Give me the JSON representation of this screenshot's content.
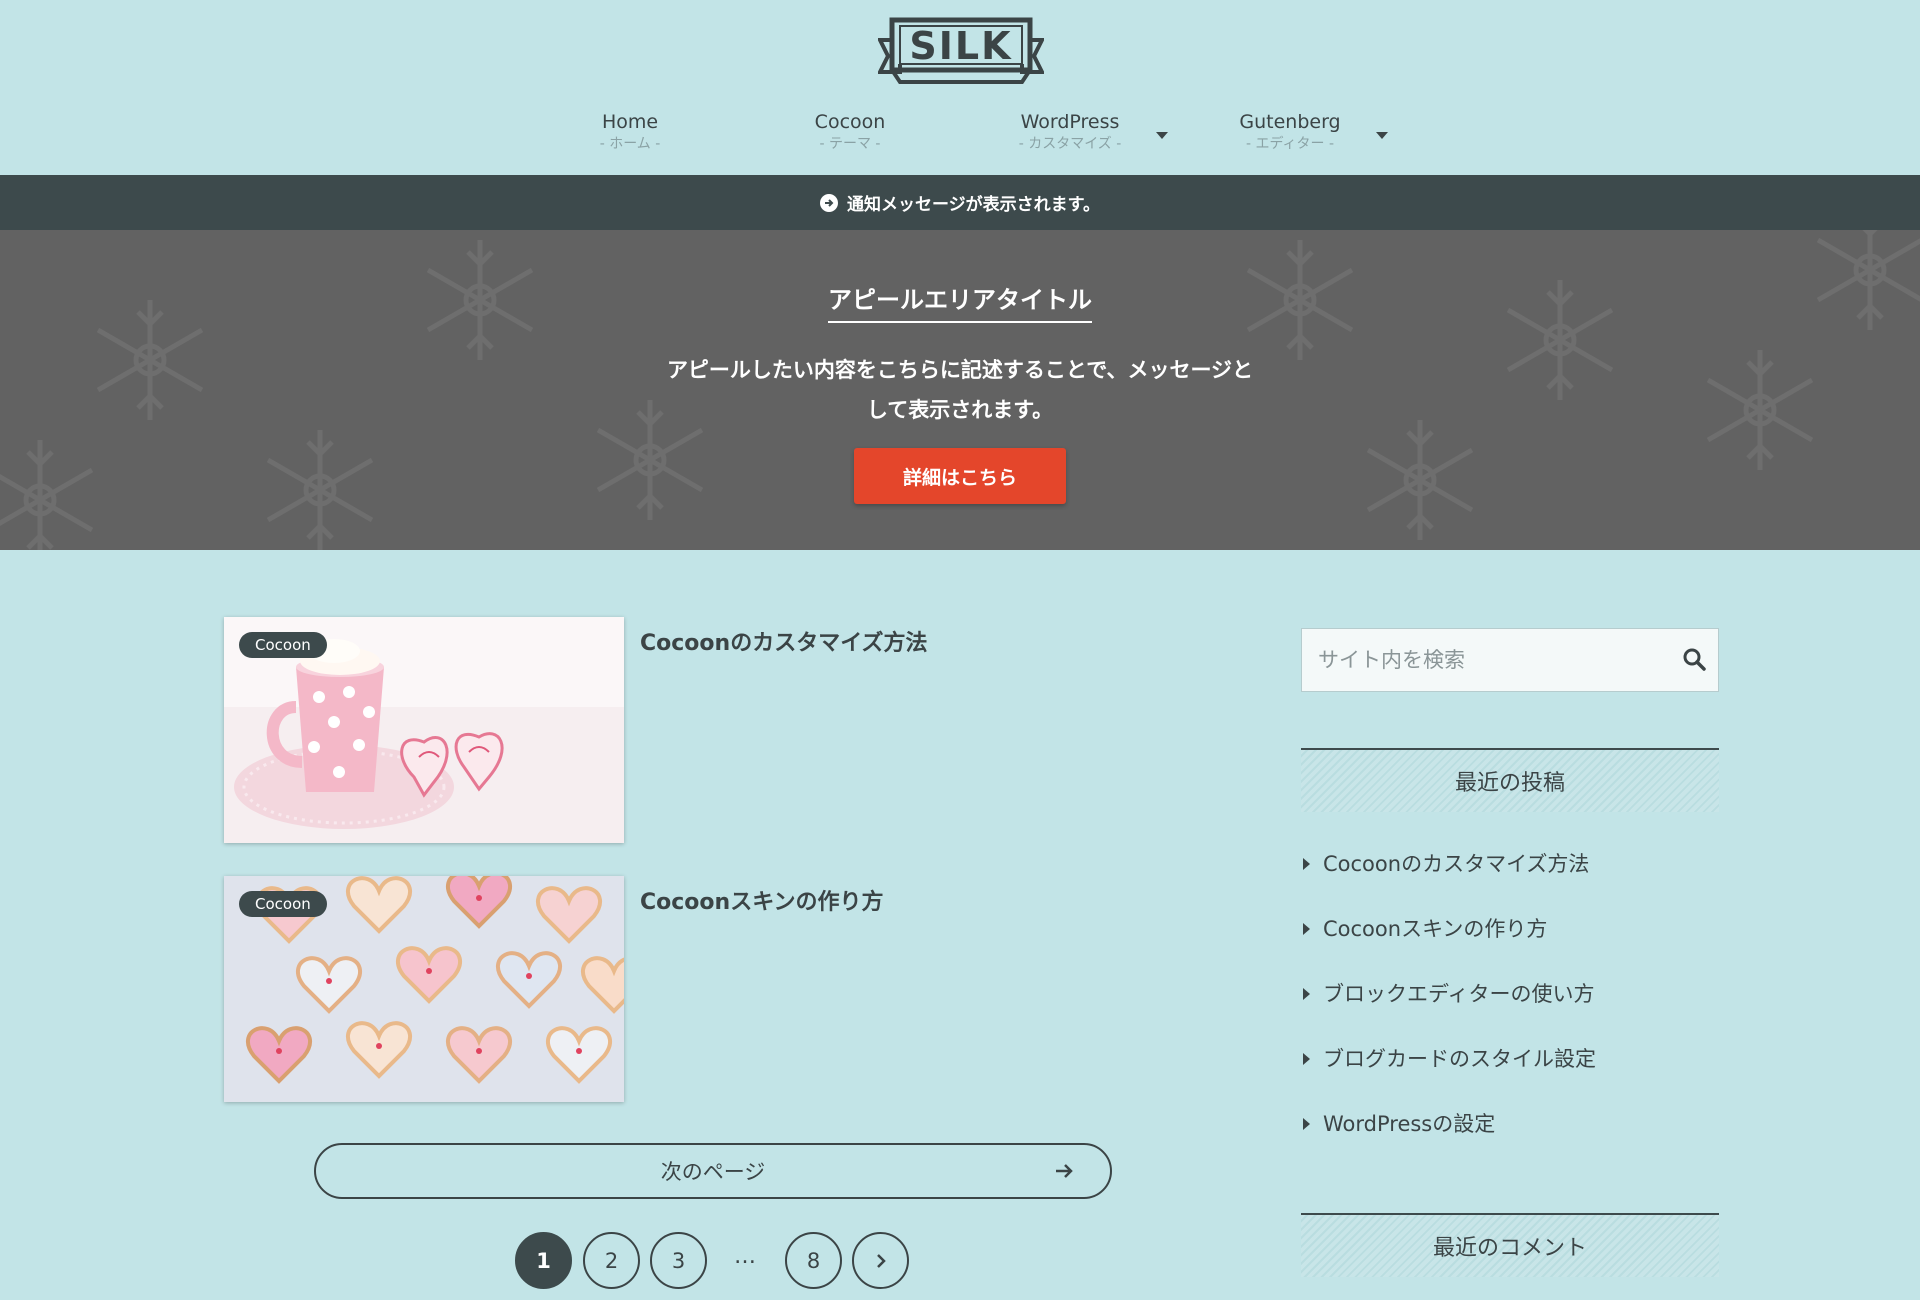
{
  "site": {
    "logo_text": "SILK"
  },
  "nav": {
    "items": [
      {
        "label": "Home",
        "sub": "- ホーム -"
      },
      {
        "label": "Cocoon",
        "sub": "- テーマ -"
      },
      {
        "label": "WordPress",
        "sub": "- カスタマイズ -"
      },
      {
        "label": "Gutenberg",
        "sub": "- エディター -"
      }
    ]
  },
  "notice": {
    "text": "通知メッセージが表示されます。",
    "icon": "arrow-right-circle-icon"
  },
  "appeal": {
    "title": "アピールエリアタイトル",
    "message_line1": "アピールしたい内容をこちらに記述することで、メッセージと",
    "message_line2": "して表示されます。",
    "button_label": "詳細はこちら",
    "button_color": "#e4462b"
  },
  "posts": [
    {
      "category": "Cocoon",
      "title": "Cocoonのカスタマイズ方法"
    },
    {
      "category": "Cocoon",
      "title": "Cocoonスキンの作り方"
    }
  ],
  "next_page": {
    "label": "次のページ"
  },
  "pagination": {
    "pages": [
      "1",
      "2",
      "3",
      "8"
    ],
    "ellipsis": "…",
    "current": "1"
  },
  "sidebar": {
    "search_placeholder": "サイト内を検索",
    "recent_title": "最近の投稿",
    "recent_posts": [
      "Cocoonのカスタマイズ方法",
      "Cocoonスキンの作り方",
      "ブロックエディターの使い方",
      "ブログカードのスタイル設定",
      "WordPressの設定"
    ],
    "comments_title": "最近のコメント"
  },
  "colors": {
    "background": "#c2e4e7",
    "dark": "#3d4a4c",
    "accent": "#e4462b"
  }
}
